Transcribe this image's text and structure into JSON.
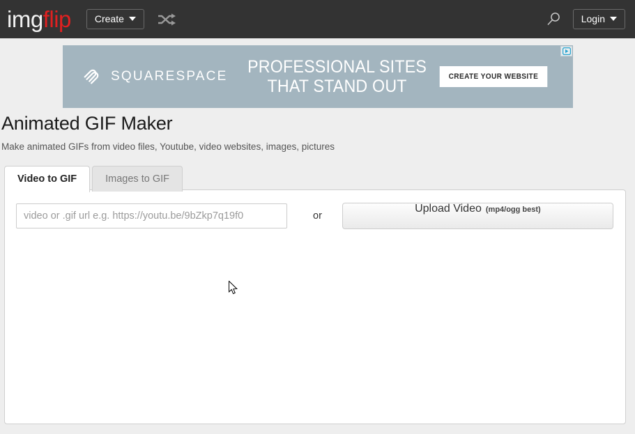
{
  "header": {
    "logo_img": "img",
    "logo_flip": "flip",
    "create_label": "Create",
    "shuffle_icon": "shuffle-icon",
    "search_icon": "search-icon",
    "login_label": "Login"
  },
  "ad": {
    "brand": "SQUARESPACE",
    "headline_line1": "PROFESSIONAL SITES",
    "headline_line2": "THAT STAND OUT",
    "cta_label": "CREATE YOUR WEBSITE",
    "adchoices_icon": "adchoices-icon",
    "background_color": "#a3b5bf"
  },
  "page": {
    "title": "Animated GIF Maker",
    "subtitle": "Make animated GIFs from video files, Youtube, video websites, images, pictures"
  },
  "tabs": [
    {
      "label": "Video to GIF",
      "active": true
    },
    {
      "label": "Images to GIF",
      "active": false
    }
  ],
  "form": {
    "url_placeholder": "video or .gif url e.g. https://youtu.be/9bZkp7q19f0",
    "url_value": "",
    "or_label": "or",
    "upload_label": "Upload Video",
    "upload_hint": "(mp4/ogg best)"
  },
  "colors": {
    "header_background": "#333333",
    "page_background": "#eeeeee",
    "accent_red": "#e02020",
    "panel_background": "#ffffff"
  }
}
